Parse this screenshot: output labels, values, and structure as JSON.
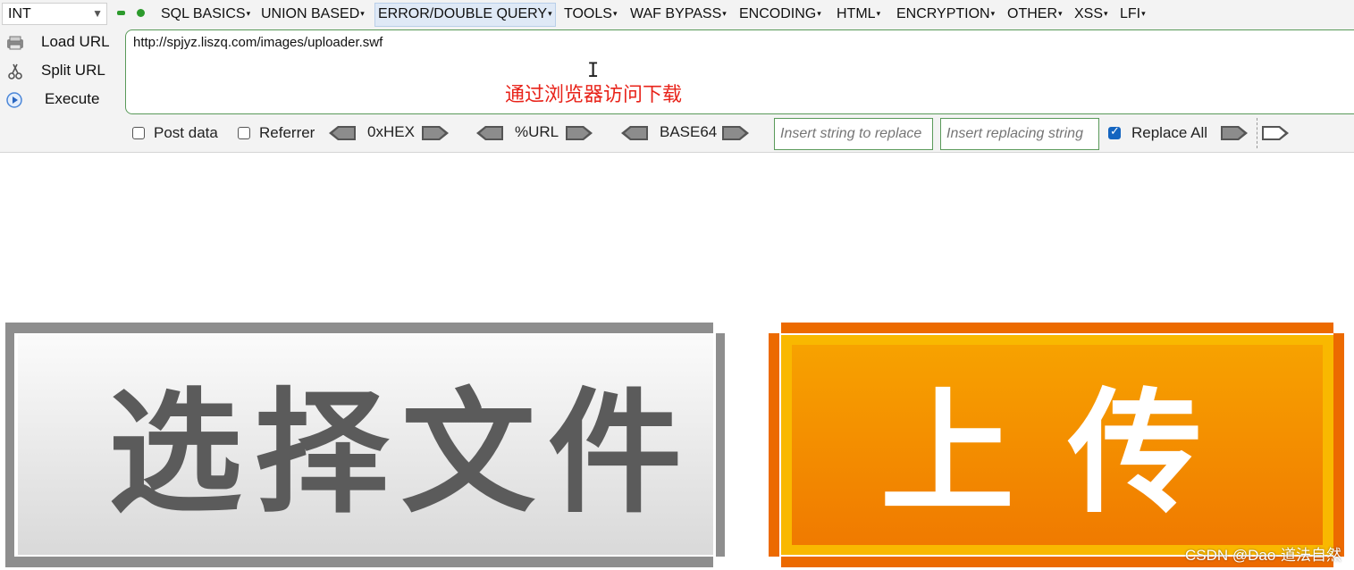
{
  "hackbar": {
    "type_select": "INT",
    "menus": [
      "SQL BASICS",
      "UNION BASED",
      "ERROR/DOUBLE QUERY",
      "TOOLS",
      "WAF BYPASS",
      "ENCODING",
      "HTML",
      "ENCRYPTION",
      "OTHER",
      "XSS",
      "LFI"
    ],
    "actions": {
      "load": "Load URL",
      "split": "Split URL",
      "execute": "Execute"
    },
    "url": "http://spjyz.liszq.com/images/uploader.swf",
    "annotation": "通过浏览器访问下载",
    "post_data_label": "Post data",
    "referrer_label": "Referrer",
    "hex_label": "0xHEX",
    "url_label": "%URL",
    "base64_label": "BASE64",
    "replace_placeholder": "Insert string to replace",
    "replacing_placeholder": "Insert replacing string",
    "replace_all_label": "Replace All",
    "post_data_checked": false,
    "referrer_checked": false,
    "replace_all_checked": true
  },
  "flash": {
    "choose_file_label": "选择文件",
    "upload_label": "上传"
  },
  "watermark": "CSDN @Dao-道法自然",
  "colors": {
    "accent_green": "#5a9a5a",
    "annotation_red": "#e8231a",
    "choose_gray": "#5b5b5b",
    "upload_orange": "#f59a00",
    "checkbox_blue": "#1565c0"
  }
}
